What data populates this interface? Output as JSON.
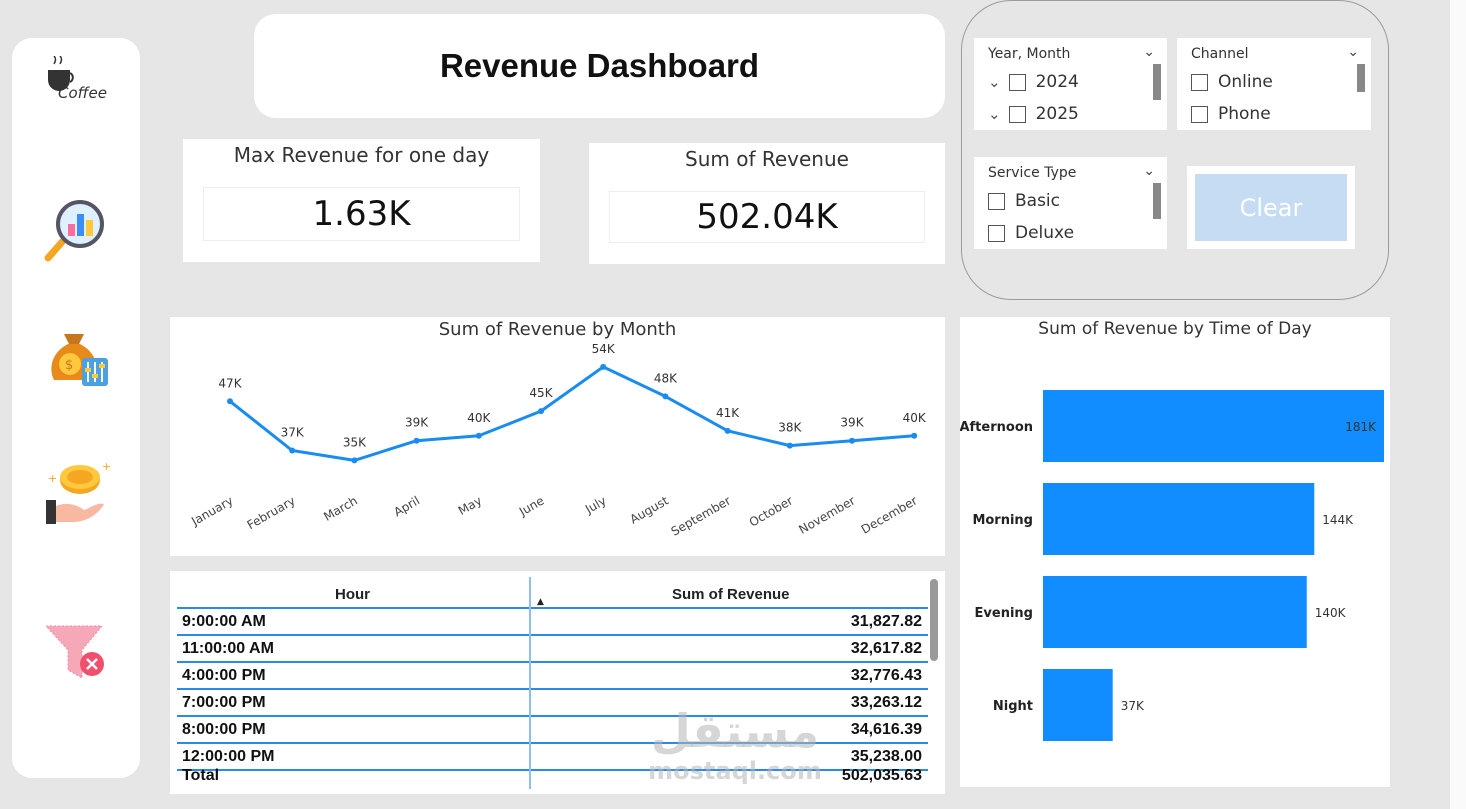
{
  "header": {
    "title": "Revenue Dashboard"
  },
  "sidebar": {
    "logo_text": "Coffee",
    "items": [
      {
        "icon": "search-analytics-icon"
      },
      {
        "icon": "money-bag-icon"
      },
      {
        "icon": "coin-hand-icon"
      },
      {
        "icon": "filter-clear-icon"
      }
    ]
  },
  "kpis": {
    "max_day": {
      "label": "Max Revenue for one day",
      "value": "1.63K"
    },
    "sum": {
      "label": "Sum of Revenue",
      "value": "502.04K"
    }
  },
  "filters": {
    "year_month": {
      "title": "Year, Month",
      "options": [
        "2024",
        "2025"
      ]
    },
    "channel": {
      "title": "Channel",
      "options": [
        "Online",
        "Phone"
      ]
    },
    "service_type": {
      "title": "Service Type",
      "options": [
        "Basic",
        "Deluxe"
      ]
    },
    "clear_label": "Clear"
  },
  "chart_data": [
    {
      "type": "line",
      "title": "Sum of Revenue by Month",
      "categories": [
        "January",
        "February",
        "March",
        "April",
        "May",
        "June",
        "July",
        "August",
        "September",
        "October",
        "November",
        "December"
      ],
      "values": [
        47,
        37,
        35,
        39,
        40,
        45,
        54,
        48,
        41,
        38,
        39,
        40
      ],
      "data_labels": [
        "47K",
        "37K",
        "35K",
        "39K",
        "40K",
        "45K",
        "54K",
        "48K",
        "41K",
        "38K",
        "39K",
        "40K"
      ],
      "unit": "K",
      "color": "#1a8cf0"
    },
    {
      "type": "bar",
      "orientation": "horizontal",
      "title": "Sum of Revenue by Time of Day",
      "categories": [
        "Afternoon",
        "Morning",
        "Evening",
        "Night"
      ],
      "values": [
        181,
        144,
        140,
        37
      ],
      "data_labels": [
        "181K",
        "144K",
        "140K",
        "37K"
      ],
      "unit": "K",
      "color": "#118dff"
    }
  ],
  "table": {
    "columns": [
      "Hour",
      "Sum of Revenue"
    ],
    "rows": [
      [
        "9:00:00 AM",
        "31,827.82"
      ],
      [
        "11:00:00 AM",
        "32,617.82"
      ],
      [
        "4:00:00 PM",
        "32,776.43"
      ],
      [
        "7:00:00 PM",
        "33,263.12"
      ],
      [
        "8:00:00 PM",
        "34,616.39"
      ],
      [
        "12:00:00 PM",
        "35,238.00"
      ]
    ],
    "total_label": "Total",
    "total_value": "502,035.63"
  },
  "watermark": {
    "arabic": "مستقل",
    "latin": "mostaql.com"
  },
  "colors": {
    "accent": "#1a8cf0",
    "background": "#e6e6e6",
    "clear_button": "#c5dcf3"
  }
}
